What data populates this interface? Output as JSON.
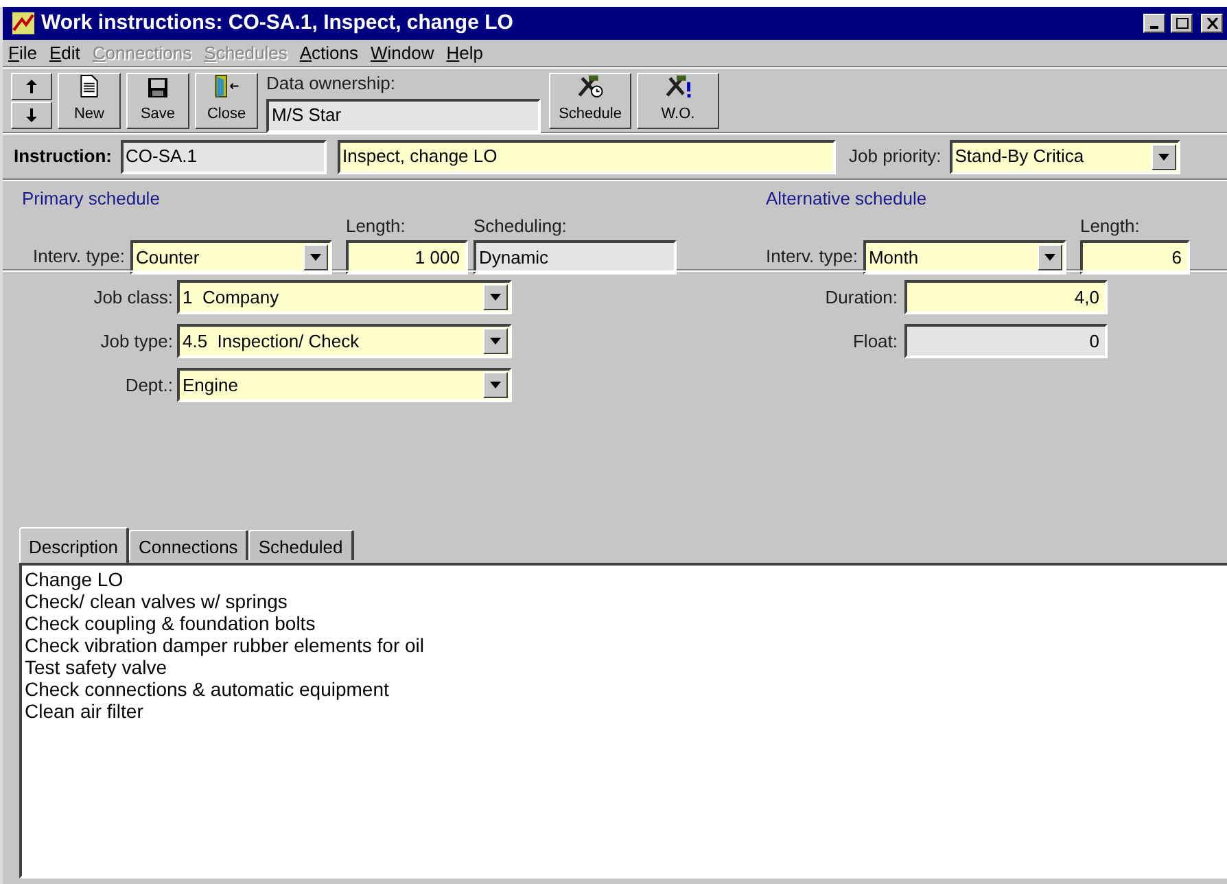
{
  "window": {
    "title": "Work instructions: CO-SA.1, Inspect, change LO"
  },
  "menu": [
    {
      "label": "File",
      "disabled": false
    },
    {
      "label": "Edit",
      "disabled": false
    },
    {
      "label": "Connections",
      "disabled": true
    },
    {
      "label": "Schedules",
      "disabled": true
    },
    {
      "label": "Actions",
      "disabled": false
    },
    {
      "label": "Window",
      "disabled": false
    },
    {
      "label": "Help",
      "disabled": false
    }
  ],
  "toolbar": {
    "left_buttons": [
      {
        "label": "New",
        "kind": "new"
      },
      {
        "label": "Save",
        "kind": "save"
      },
      {
        "label": "Close",
        "kind": "close"
      }
    ],
    "data_ownership": {
      "label": "Data ownership:",
      "value": "M/S Star",
      "editable": false
    },
    "right_buttons": [
      {
        "label": "Schedule",
        "kind": "schedule"
      },
      {
        "label": "W.O.",
        "kind": "wo"
      }
    ]
  },
  "instruction": {
    "label": "Instruction:",
    "code": {
      "value": "CO-SA.1",
      "editable": false
    },
    "name": {
      "value": "Inspect, change LO",
      "editable": true
    },
    "priority_label": "Job priority:",
    "priority": {
      "value": "Stand-By Critica",
      "editable": true
    }
  },
  "primary_schedule": {
    "title": "Primary schedule",
    "interval_label": "Interv. type:",
    "interval": {
      "value": "Counter",
      "editable": true
    },
    "length_label": "Length:",
    "length": {
      "value": "1 000",
      "editable": true
    },
    "scheduling_label": "Scheduling:",
    "scheduling": {
      "value": "Dynamic",
      "editable": false
    }
  },
  "alternative_schedule": {
    "title": "Alternative schedule",
    "interval_label": "Interv. type:",
    "interval": {
      "value": "Month",
      "editable": true
    },
    "length_label": "Length:",
    "length": {
      "value": "6",
      "editable": true
    }
  },
  "job": {
    "class_label": "Job class:",
    "class": {
      "value": "1  Company",
      "editable": true
    },
    "type_label": "Job type:",
    "type": {
      "value": "4.5  Inspection/ Check",
      "editable": true
    },
    "dept_label": "Dept.:",
    "dept": {
      "value": "Engine",
      "editable": true
    },
    "duration_label": "Duration:",
    "duration": {
      "value": "4,0",
      "editable": true
    },
    "float_label": "Float:",
    "float": {
      "value": "0",
      "editable": false
    }
  },
  "tabs": [
    {
      "label": "Description",
      "selected": true
    },
    {
      "label": "Connections",
      "selected": false
    },
    {
      "label": "Scheduled",
      "selected": false
    }
  ],
  "description_lines": [
    "Change LO",
    "Check/ clean valves w/ springs",
    "Check coupling & foundation bolts",
    "Check vibration damper rubber elements for oil",
    "Test safety valve",
    "Check connections & automatic equipment",
    "Clean air filter"
  ]
}
